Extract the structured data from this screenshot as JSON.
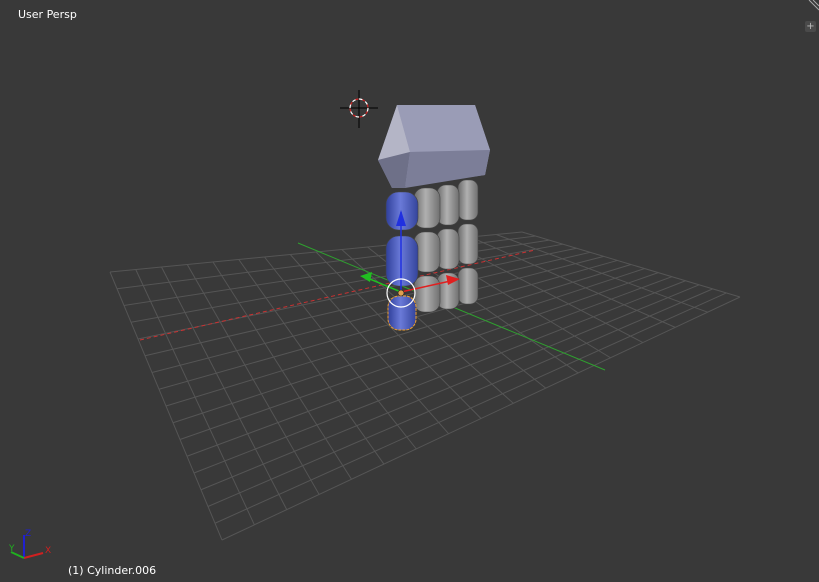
{
  "viewport": {
    "view_name": "User Persp",
    "active_object": "(1) Cylinder.006",
    "toolshelf_toggle": "+",
    "gizmo": {
      "x": "X",
      "y": "Y",
      "z": "Z"
    },
    "colors": {
      "background": "#393939",
      "grid": "#555555",
      "x_axis": "#c83232",
      "y_axis": "#32a032",
      "z_axis": "#1e1ecc",
      "selection": "#f0a030",
      "body": "#8a8a8a",
      "selected_body": "#4a5ab0",
      "head": "#8c8ea8"
    }
  }
}
